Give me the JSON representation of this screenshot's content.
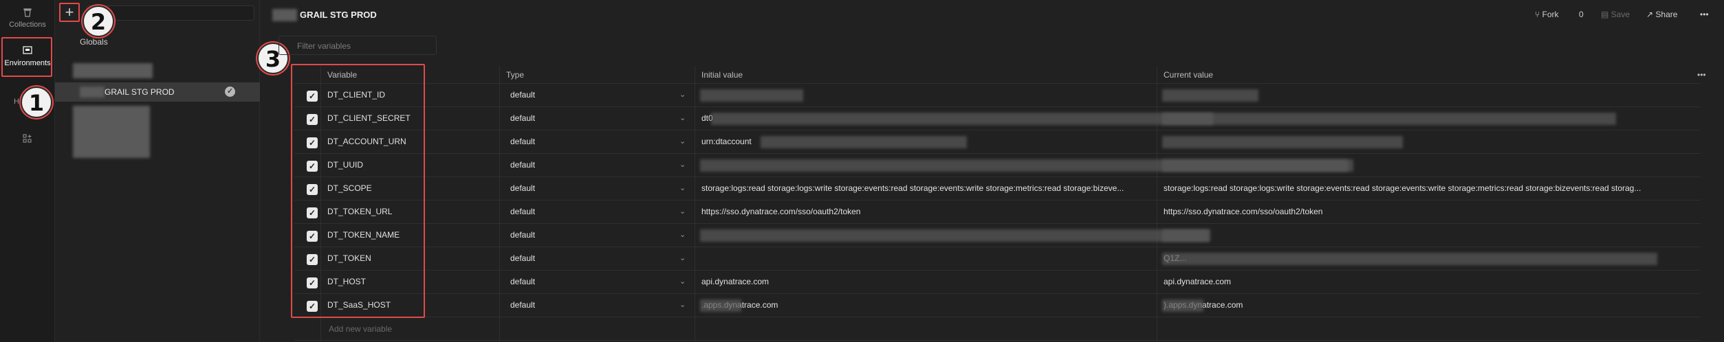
{
  "rail": {
    "items": [
      {
        "label": "Collections",
        "icon": "trash-can-icon"
      },
      {
        "label": "Environments",
        "icon": "environment-icon"
      },
      {
        "label": "H",
        "icon": "history-icon"
      },
      {
        "label": "",
        "icon": "apps-grid-icon"
      }
    ]
  },
  "sidebar": {
    "add_symbol": "+",
    "globals_label": "Globals",
    "env_label": "GRAIL STG PROD"
  },
  "annotations": [
    "1",
    "2",
    "3"
  ],
  "header": {
    "title": "GRAIL STG PROD",
    "fork_label": "Fork",
    "fork_count": "0",
    "save_label": "Save",
    "share_label": "Share",
    "more_label": "•••",
    "filter_placeholder": "Filter variables"
  },
  "table": {
    "columns": [
      "Variable",
      "Type",
      "Initial value",
      "Current value"
    ],
    "more_label": "•••",
    "add_new": "Add new variable",
    "rows": [
      {
        "variable": "DT_CLIENT_ID",
        "type": "default",
        "initial": "",
        "current": ""
      },
      {
        "variable": "DT_CLIENT_SECRET",
        "type": "default",
        "initial": "dt0",
        "current": ""
      },
      {
        "variable": "DT_ACCOUNT_URN",
        "type": "default",
        "initial": "urn:dtaccount",
        "current": ""
      },
      {
        "variable": "DT_UUID",
        "type": "default",
        "initial": "",
        "current": ""
      },
      {
        "variable": "DT_SCOPE",
        "type": "default",
        "initial": "storage:logs:read storage:logs:write storage:events:read storage:events:write storage:metrics:read storage:bizeve...",
        "current": "storage:logs:read storage:logs:write storage:events:read storage:events:write storage:metrics:read storage:bizevents:read storag..."
      },
      {
        "variable": "DT_TOKEN_URL",
        "type": "default",
        "initial": "https://sso.dynatrace.com/sso/oauth2/token",
        "current": "https://sso.dynatrace.com/sso/oauth2/token"
      },
      {
        "variable": "DT_TOKEN_NAME",
        "type": "default",
        "initial": "",
        "current": ""
      },
      {
        "variable": "DT_TOKEN",
        "type": "default",
        "initial": "",
        "current": "Q1Z..."
      },
      {
        "variable": "DT_HOST",
        "type": "default",
        "initial": "api.dynatrace.com",
        "current": "api.dynatrace.com"
      },
      {
        "variable": "DT_SaaS_HOST",
        "type": "default",
        "initial": ".apps.dynatrace.com",
        "current": ").apps.dynatrace.com"
      }
    ]
  },
  "colors": {
    "accent_red": "#e24a4a",
    "background": "#212121"
  }
}
